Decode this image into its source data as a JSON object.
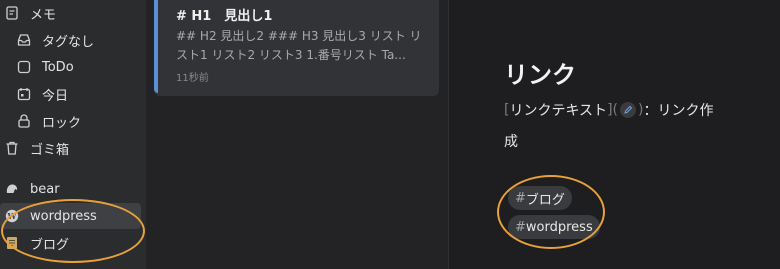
{
  "sidebar": {
    "memo": "メモ",
    "untagged": "タグなし",
    "todo": "ToDo",
    "today": "今日",
    "locked": "ロック",
    "trash": "ゴミ箱",
    "tags": [
      "bear",
      "wordpress",
      "ブログ"
    ],
    "selected": "wordpress"
  },
  "note": {
    "title": "# H1　見出し1",
    "snippet": "## H2 見出し2 ### H3 見出し3 リスト リスト1 リスト2 リスト3 1.番号リスト Ta...",
    "time": "11秒前"
  },
  "editor": {
    "heading": "リンク",
    "link_open": "[",
    "link_text": "リンクテキスト",
    "link_close": "]",
    "paren_open": "(",
    "paren_close": ")",
    "link_desc": "：リンク作",
    "link_desc_cont": "成",
    "tags": [
      {
        "hash": "#",
        "label": "ブログ"
      },
      {
        "hash": "#",
        "label": "wordpress"
      }
    ]
  },
  "colors": {
    "accent": "#5b8fd6",
    "highlight_ring": "#e8a13a"
  }
}
